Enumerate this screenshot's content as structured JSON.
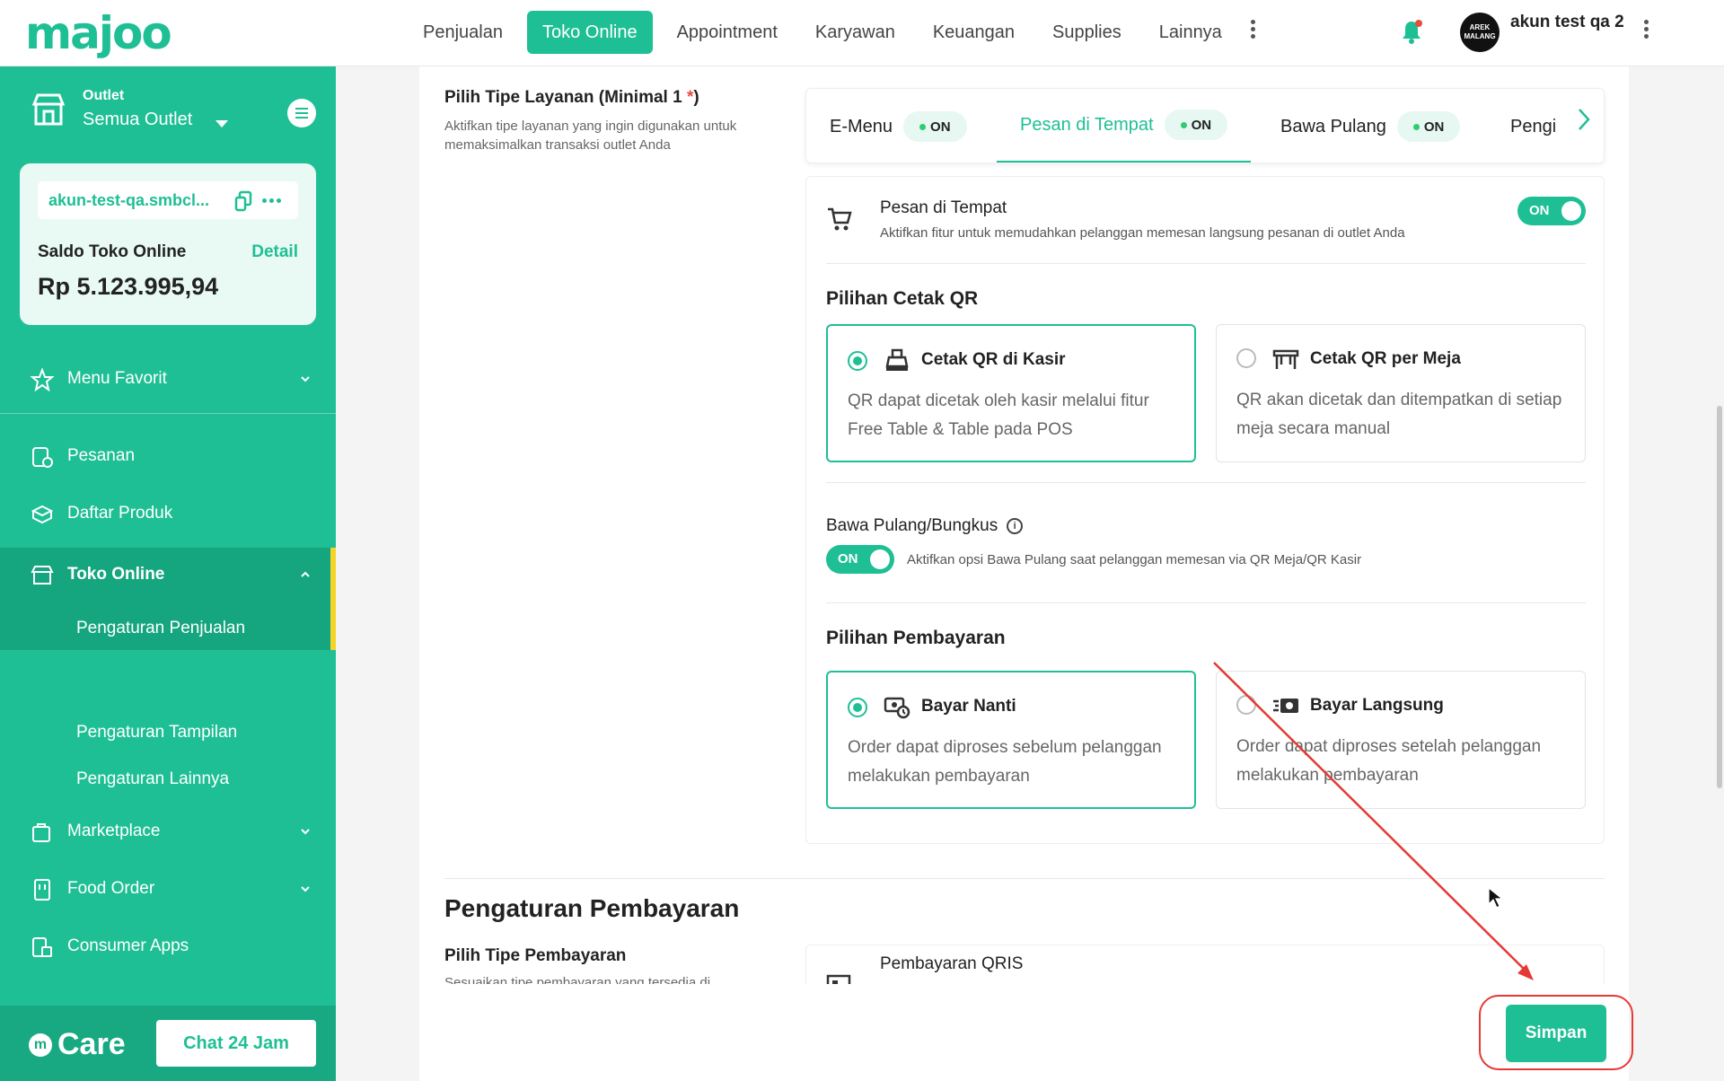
{
  "header": {
    "logo": "majoo",
    "nav": [
      "Penjualan",
      "Toko Online",
      "Appointment",
      "Karyawan",
      "Keuangan",
      "Supplies",
      "Lainnya"
    ],
    "active_nav": "Toko Online",
    "avatar_text": "AREK MALANG",
    "username": "akun test qa 2"
  },
  "sidebar": {
    "outlet_label": "Outlet",
    "outlet_value": "Semua Outlet",
    "store_url": "akun-test-qa.smbcl...",
    "saldo_label": "Saldo Toko Online",
    "saldo_detail": "Detail",
    "saldo_value": "Rp 5.123.995,94",
    "menu_favorit": "Menu Favorit",
    "items": [
      {
        "label": "Pesanan",
        "icon": "order-icon"
      },
      {
        "label": "Daftar Produk",
        "icon": "box-icon"
      },
      {
        "label": "Toko Online",
        "icon": "store-icon"
      },
      {
        "label": "Marketplace",
        "icon": "marketplace-icon"
      },
      {
        "label": "Food Order",
        "icon": "food-icon"
      },
      {
        "label": "Consumer Apps",
        "icon": "apps-icon"
      }
    ],
    "sub_items": [
      "Pengaturan Penjualan",
      "Pengaturan Tampilan",
      "Pengaturan Lainnya"
    ],
    "care_label": "Care",
    "chat_button": "Chat 24 Jam"
  },
  "service": {
    "title": "Pilih Tipe Layanan (Minimal 1",
    "required_mark": "*",
    "title_close": ")",
    "description": "Aktifkan tipe layanan yang ingin digunakan untuk memaksimalkan transaksi outlet Anda",
    "tabs": [
      {
        "label": "E-Menu",
        "status": "ON"
      },
      {
        "label": "Pesan di Tempat",
        "status": "ON"
      },
      {
        "label": "Bawa Pulang",
        "status": "ON"
      },
      {
        "label": "Pengi",
        "status": ""
      }
    ],
    "active_tab": "Pesan di Tempat"
  },
  "pesan_di_tempat": {
    "title": "Pesan di Tempat",
    "description": "Aktifkan fitur untuk memudahkan pelanggan memesan langsung pesanan di outlet Anda",
    "toggle": "ON"
  },
  "cetak_qr": {
    "heading": "Pilihan Cetak QR",
    "options": [
      {
        "title": "Cetak QR di Kasir",
        "description": "QR dapat dicetak oleh kasir melalui fitur Free Table & Table pada POS",
        "selected": true
      },
      {
        "title": "Cetak QR per Meja",
        "description": "QR akan dicetak dan ditempatkan di setiap meja secara manual",
        "selected": false
      }
    ]
  },
  "bawa_pulang": {
    "title": "Bawa Pulang/Bungkus",
    "toggle": "ON",
    "description": "Aktifkan opsi Bawa Pulang saat pelanggan memesan via QR Meja/QR Kasir"
  },
  "pembayaran": {
    "heading": "Pilihan Pembayaran",
    "options": [
      {
        "title": "Bayar Nanti",
        "description": "Order dapat diproses sebelum pelanggan melakukan pembayaran",
        "selected": true
      },
      {
        "title": "Bayar Langsung",
        "description": "Order dapat diproses setelah pelanggan melakukan pembayaran",
        "selected": false
      }
    ]
  },
  "pengaturan_pembayaran": {
    "heading": "Pengaturan Pembayaran",
    "type_title": "Pilih Tipe Pembayaran",
    "type_desc": "Sesuaikan tipe pembayaran yang tersedia di",
    "qris_label": "Pembayaran QRIS"
  },
  "footer": {
    "save_button": "Simpan"
  },
  "colors": {
    "brand": "#1fbf95",
    "annotation": "#e53935",
    "active_marker": "#f5d327"
  }
}
